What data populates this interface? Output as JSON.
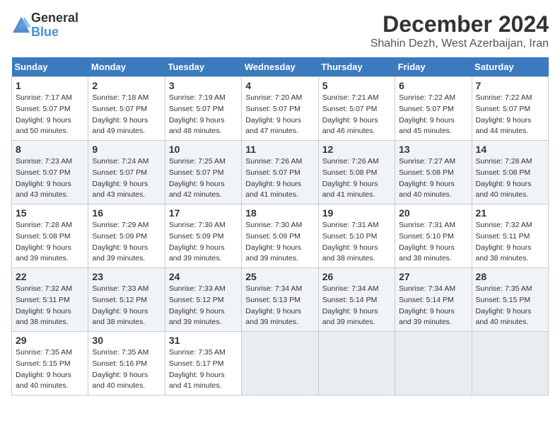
{
  "header": {
    "logo_general": "General",
    "logo_blue": "Blue",
    "title": "December 2024",
    "subtitle": "Shahin Dezh, West Azerbaijan, Iran"
  },
  "days_of_week": [
    "Sunday",
    "Monday",
    "Tuesday",
    "Wednesday",
    "Thursday",
    "Friday",
    "Saturday"
  ],
  "weeks": [
    [
      {
        "num": "1",
        "lines": [
          "Sunrise: 7:17 AM",
          "Sunset: 5:07 PM",
          "Daylight: 9 hours",
          "and 50 minutes."
        ]
      },
      {
        "num": "2",
        "lines": [
          "Sunrise: 7:18 AM",
          "Sunset: 5:07 PM",
          "Daylight: 9 hours",
          "and 49 minutes."
        ]
      },
      {
        "num": "3",
        "lines": [
          "Sunrise: 7:19 AM",
          "Sunset: 5:07 PM",
          "Daylight: 9 hours",
          "and 48 minutes."
        ]
      },
      {
        "num": "4",
        "lines": [
          "Sunrise: 7:20 AM",
          "Sunset: 5:07 PM",
          "Daylight: 9 hours",
          "and 47 minutes."
        ]
      },
      {
        "num": "5",
        "lines": [
          "Sunrise: 7:21 AM",
          "Sunset: 5:07 PM",
          "Daylight: 9 hours",
          "and 46 minutes."
        ]
      },
      {
        "num": "6",
        "lines": [
          "Sunrise: 7:22 AM",
          "Sunset: 5:07 PM",
          "Daylight: 9 hours",
          "and 45 minutes."
        ]
      },
      {
        "num": "7",
        "lines": [
          "Sunrise: 7:22 AM",
          "Sunset: 5:07 PM",
          "Daylight: 9 hours",
          "and 44 minutes."
        ]
      }
    ],
    [
      {
        "num": "8",
        "lines": [
          "Sunrise: 7:23 AM",
          "Sunset: 5:07 PM",
          "Daylight: 9 hours",
          "and 43 minutes."
        ]
      },
      {
        "num": "9",
        "lines": [
          "Sunrise: 7:24 AM",
          "Sunset: 5:07 PM",
          "Daylight: 9 hours",
          "and 43 minutes."
        ]
      },
      {
        "num": "10",
        "lines": [
          "Sunrise: 7:25 AM",
          "Sunset: 5:07 PM",
          "Daylight: 9 hours",
          "and 42 minutes."
        ]
      },
      {
        "num": "11",
        "lines": [
          "Sunrise: 7:26 AM",
          "Sunset: 5:07 PM",
          "Daylight: 9 hours",
          "and 41 minutes."
        ]
      },
      {
        "num": "12",
        "lines": [
          "Sunrise: 7:26 AM",
          "Sunset: 5:08 PM",
          "Daylight: 9 hours",
          "and 41 minutes."
        ]
      },
      {
        "num": "13",
        "lines": [
          "Sunrise: 7:27 AM",
          "Sunset: 5:08 PM",
          "Daylight: 9 hours",
          "and 40 minutes."
        ]
      },
      {
        "num": "14",
        "lines": [
          "Sunrise: 7:28 AM",
          "Sunset: 5:08 PM",
          "Daylight: 9 hours",
          "and 40 minutes."
        ]
      }
    ],
    [
      {
        "num": "15",
        "lines": [
          "Sunrise: 7:28 AM",
          "Sunset: 5:08 PM",
          "Daylight: 9 hours",
          "and 39 minutes."
        ]
      },
      {
        "num": "16",
        "lines": [
          "Sunrise: 7:29 AM",
          "Sunset: 5:09 PM",
          "Daylight: 9 hours",
          "and 39 minutes."
        ]
      },
      {
        "num": "17",
        "lines": [
          "Sunrise: 7:30 AM",
          "Sunset: 5:09 PM",
          "Daylight: 9 hours",
          "and 39 minutes."
        ]
      },
      {
        "num": "18",
        "lines": [
          "Sunrise: 7:30 AM",
          "Sunset: 5:09 PM",
          "Daylight: 9 hours",
          "and 39 minutes."
        ]
      },
      {
        "num": "19",
        "lines": [
          "Sunrise: 7:31 AM",
          "Sunset: 5:10 PM",
          "Daylight: 9 hours",
          "and 38 minutes."
        ]
      },
      {
        "num": "20",
        "lines": [
          "Sunrise: 7:31 AM",
          "Sunset: 5:10 PM",
          "Daylight: 9 hours",
          "and 38 minutes."
        ]
      },
      {
        "num": "21",
        "lines": [
          "Sunrise: 7:32 AM",
          "Sunset: 5:11 PM",
          "Daylight: 9 hours",
          "and 38 minutes."
        ]
      }
    ],
    [
      {
        "num": "22",
        "lines": [
          "Sunrise: 7:32 AM",
          "Sunset: 5:11 PM",
          "Daylight: 9 hours",
          "and 38 minutes."
        ]
      },
      {
        "num": "23",
        "lines": [
          "Sunrise: 7:33 AM",
          "Sunset: 5:12 PM",
          "Daylight: 9 hours",
          "and 38 minutes."
        ]
      },
      {
        "num": "24",
        "lines": [
          "Sunrise: 7:33 AM",
          "Sunset: 5:12 PM",
          "Daylight: 9 hours",
          "and 39 minutes."
        ]
      },
      {
        "num": "25",
        "lines": [
          "Sunrise: 7:34 AM",
          "Sunset: 5:13 PM",
          "Daylight: 9 hours",
          "and 39 minutes."
        ]
      },
      {
        "num": "26",
        "lines": [
          "Sunrise: 7:34 AM",
          "Sunset: 5:14 PM",
          "Daylight: 9 hours",
          "and 39 minutes."
        ]
      },
      {
        "num": "27",
        "lines": [
          "Sunrise: 7:34 AM",
          "Sunset: 5:14 PM",
          "Daylight: 9 hours",
          "and 39 minutes."
        ]
      },
      {
        "num": "28",
        "lines": [
          "Sunrise: 7:35 AM",
          "Sunset: 5:15 PM",
          "Daylight: 9 hours",
          "and 40 minutes."
        ]
      }
    ],
    [
      {
        "num": "29",
        "lines": [
          "Sunrise: 7:35 AM",
          "Sunset: 5:15 PM",
          "Daylight: 9 hours",
          "and 40 minutes."
        ]
      },
      {
        "num": "30",
        "lines": [
          "Sunrise: 7:35 AM",
          "Sunset: 5:16 PM",
          "Daylight: 9 hours",
          "and 40 minutes."
        ]
      },
      {
        "num": "31",
        "lines": [
          "Sunrise: 7:35 AM",
          "Sunset: 5:17 PM",
          "Daylight: 9 hours",
          "and 41 minutes."
        ]
      },
      null,
      null,
      null,
      null
    ]
  ]
}
